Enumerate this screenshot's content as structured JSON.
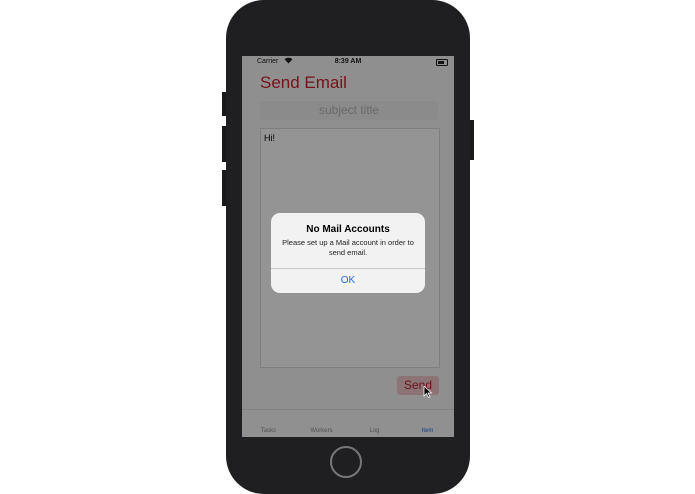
{
  "status_bar": {
    "carrier": "Carrier",
    "time": "8:39 AM"
  },
  "screen": {
    "title": "Send Email",
    "subject_placeholder": "subject title",
    "body_text": "Hi!",
    "send_label": "Send"
  },
  "tabs": [
    {
      "label": "Tasks",
      "active": false
    },
    {
      "label": "Workers",
      "active": false
    },
    {
      "label": "Log",
      "active": false
    },
    {
      "label": "Item",
      "active": true
    }
  ],
  "alert": {
    "title": "No Mail Accounts",
    "message": "Please set up a Mail account in order to send email.",
    "ok_label": "OK"
  },
  "colors": {
    "accent_red": "#d02030",
    "ios_blue": "#1f6fe0"
  }
}
